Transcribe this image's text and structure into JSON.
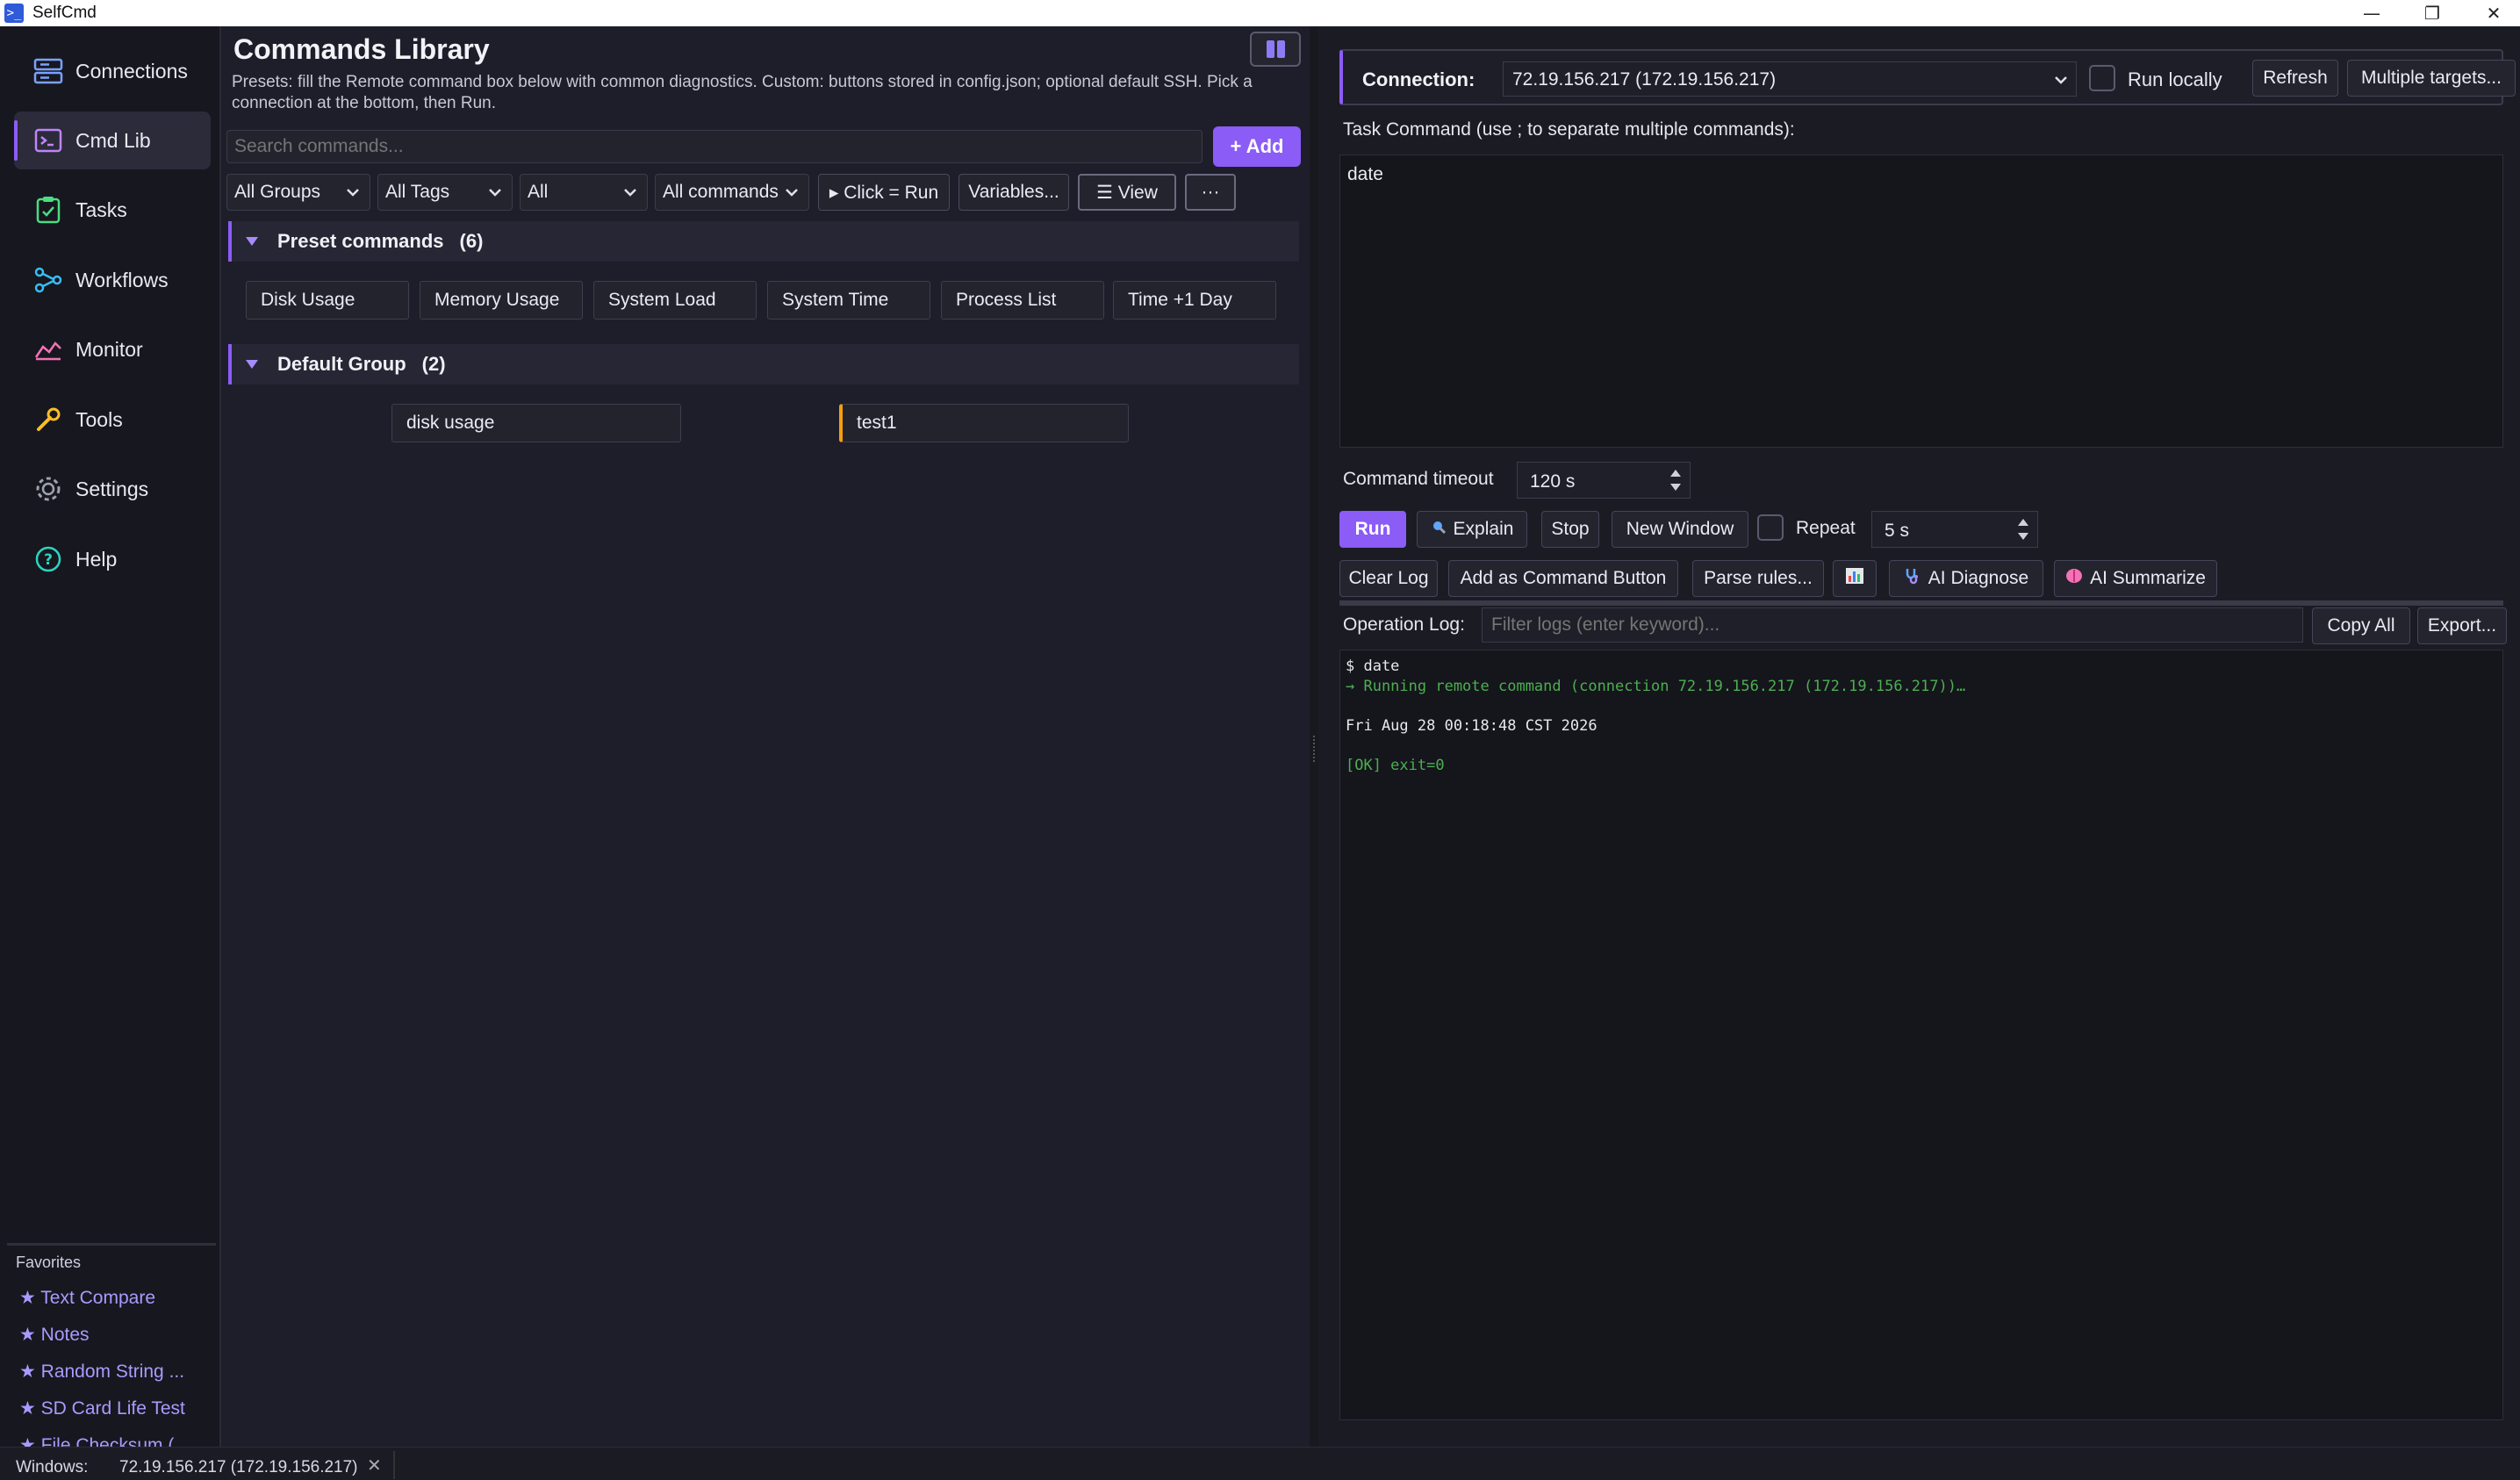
{
  "window": {
    "title": "SelfCmd",
    "minimize": "—",
    "restore": "❐",
    "close": "✕"
  },
  "sidebar": {
    "items": [
      {
        "label": "Connections",
        "icon": "server-icon"
      },
      {
        "label": "Cmd Lib",
        "icon": "terminal-icon"
      },
      {
        "label": "Tasks",
        "icon": "clipboard-icon"
      },
      {
        "label": "Workflows",
        "icon": "share-icon"
      },
      {
        "label": "Monitor",
        "icon": "chart-line-icon"
      },
      {
        "label": "Tools",
        "icon": "wrench-icon"
      },
      {
        "label": "Settings",
        "icon": "gear-icon"
      },
      {
        "label": "Help",
        "icon": "help-icon"
      }
    ],
    "favorites_title": "Favorites",
    "favorites": [
      "★ Text Compare",
      "★ Notes",
      "★ Random String ...",
      "★ SD Card Life Test",
      "★ File Checksum (..."
    ]
  },
  "library": {
    "title": "Commands Library",
    "description": "Presets: fill the Remote command box below with common diagnostics. Custom: buttons stored in config.json; optional default SSH. Pick a connection at the bottom, then Run.",
    "search_placeholder": "Search commands...",
    "add_label": "+ Add",
    "filters": {
      "groups": "All Groups",
      "tags": "All Tags",
      "scope": "All",
      "commands": "All commands"
    },
    "click_run_label": "▸ Click = Run",
    "variables_label": "Variables...",
    "view_label": "☰ View",
    "more_label": "···",
    "groups": [
      {
        "name": "Preset commands",
        "count": "(6)",
        "commands": [
          "Disk Usage",
          "Memory Usage",
          "System Load",
          "System Time",
          "Process List",
          "Time +1 Day"
        ]
      },
      {
        "name": "Default Group",
        "count": "(2)",
        "commands": [
          "disk usage",
          "test1"
        ]
      }
    ]
  },
  "runner": {
    "connection_label": "Connection:",
    "connection_value": "72.19.156.217 (172.19.156.217)",
    "run_locally_label": "Run locally",
    "refresh_label": "Refresh",
    "multiple_targets_label": "Multiple targets...",
    "task_command_label": "Task Command (use ; to separate multiple commands):",
    "task_command_value": "date",
    "timeout_label": "Command timeout",
    "timeout_value": "120 s",
    "run_label": "Run",
    "explain_label": "Explain",
    "stop_label": "Stop",
    "new_window_label": "New Window",
    "repeat_label": "Repeat",
    "repeat_value": "5 s",
    "clear_log_label": "Clear Log",
    "add_as_button_label": "Add as Command Button",
    "parse_rules_label": "Parse rules...",
    "ai_diagnose_label": "AI Diagnose",
    "ai_summarize_label": "AI Summarize",
    "operation_log_label": "Operation Log:",
    "filter_placeholder": "Filter logs (enter keyword)...",
    "copy_all_label": "Copy All",
    "export_label": "Export...",
    "log_lines": [
      "$ date",
      "→ Running remote command (connection 72.19.156.217 (172.19.156.217))…",
      "",
      "Fri Aug 28 00:18:48 CST 2026",
      "",
      "[OK] exit=0"
    ]
  },
  "status": {
    "windows_label": "Windows:",
    "window_tab": "72.19.156.217 (172.19.156.217)",
    "close": "✕"
  },
  "colors": {
    "accent": "#8b5cf6",
    "background": "#1e1e2a",
    "sidebar": "#17171f",
    "log_green": "#4caf50",
    "favorite_link": "#a89bff"
  }
}
